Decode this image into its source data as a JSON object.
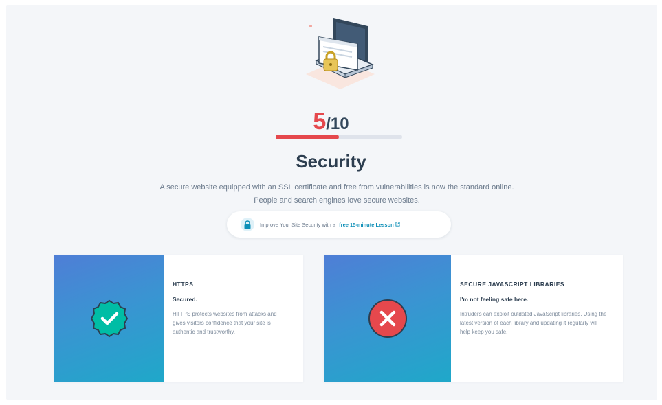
{
  "score": {
    "value": "5",
    "total": "/10",
    "fraction": 0.5
  },
  "section": {
    "title": "Security",
    "description": "A secure website equipped with an SSL certificate and free from vulnerabilities is now the standard online. People and search engines love secure websites."
  },
  "lesson": {
    "prefix": "Improve Your Site Security with a",
    "link_label": "free 15-minute Lesson",
    "link_icon": "external-link-icon"
  },
  "cards": [
    {
      "heading": "HTTPS",
      "status": "Secured.",
      "text": "HTTPS protects websites from attacks and gives visitors confidence that your site is authentic and trustworthy.",
      "icon": "check-badge-icon",
      "icon_color": "#00bda5"
    },
    {
      "heading": "SECURE JAVASCRIPT LIBRARIES",
      "status": "I'm not feeling safe here.",
      "text": "Intruders can exploit outdated JavaScript libraries. Using the latest version of each library and updating it regularly will help keep you safe.",
      "icon": "x-circle-icon",
      "icon_color": "#e5484d"
    }
  ],
  "colors": {
    "accent_red": "#e5484d",
    "link_blue": "#0d8fb7",
    "success_teal": "#00bda5"
  }
}
